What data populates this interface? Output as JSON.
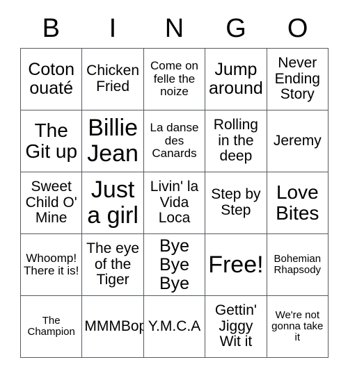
{
  "card": {
    "title": "BINGO",
    "header_letters": [
      "B",
      "I",
      "N",
      "G",
      "O"
    ],
    "free_space_label": "Free!",
    "colors": {
      "background": "#ffffff",
      "text": "#000000",
      "grid_line": "#555a5e"
    },
    "grid": {
      "rows": 5,
      "columns": 5,
      "cells": [
        [
          {
            "text": "Coton ouaté",
            "size": "lg"
          },
          {
            "text": "Chicken Fried",
            "size": "md"
          },
          {
            "text": "Come on felle the noize",
            "size": "sm"
          },
          {
            "text": "Jump around",
            "size": "lg"
          },
          {
            "text": "Never Ending Story",
            "size": "md"
          }
        ],
        [
          {
            "text": "The Git up",
            "size": "xl"
          },
          {
            "text": "Billie Jean",
            "size": "xxl"
          },
          {
            "text": "La danse des Canards",
            "size": "sm"
          },
          {
            "text": "Rolling in the deep",
            "size": "md"
          },
          {
            "text": "Jeremy",
            "size": "md"
          }
        ],
        [
          {
            "text": "Sweet Child O' Mine",
            "size": "md"
          },
          {
            "text": "Just a girl",
            "size": "xxl"
          },
          {
            "text": "Livin' la Vida Loca",
            "size": "md"
          },
          {
            "text": "Step by Step",
            "size": "md"
          },
          {
            "text": "Love Bites",
            "size": "xl"
          }
        ],
        [
          {
            "text": "Whoomp! There it is!",
            "size": "sm"
          },
          {
            "text": "The eye of the Tiger",
            "size": "md"
          },
          {
            "text": "Bye Bye Bye",
            "size": "lg"
          },
          {
            "text": "Free!",
            "size": "xxl"
          },
          {
            "text": "Bohemian Rhapsody",
            "size": "xs"
          }
        ],
        [
          {
            "text": "The Champion",
            "size": "xs"
          },
          {
            "text": "MMMBop",
            "size": "md"
          },
          {
            "text": "Y.M.C.A",
            "size": "md"
          },
          {
            "text": "Gettin' Jiggy Wit it",
            "size": "md"
          },
          {
            "text": "We're not gonna take it",
            "size": "xs"
          }
        ]
      ]
    }
  }
}
